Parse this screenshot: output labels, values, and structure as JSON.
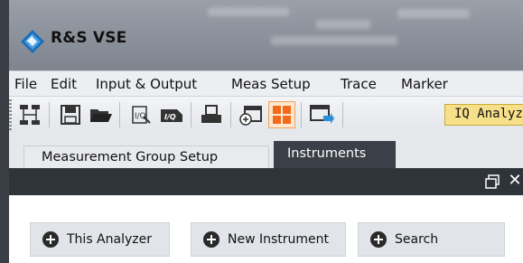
{
  "app": {
    "title": "R&S VSE"
  },
  "menu": {
    "items": [
      "File",
      "Edit",
      "Input & Output",
      "Meas Setup",
      "Trace",
      "Marker"
    ]
  },
  "toolbar": {
    "icons": [
      "measurement-overview-icon",
      "save-icon",
      "open-folder-icon",
      "print-setup-icon",
      "iq-data-icon",
      "print-icon",
      "add-window-icon",
      "layout-icon",
      "window-arrow-icon"
    ],
    "channel_label": "IQ Analyzer",
    "selected_color": "#f0a05a",
    "channel_color": "#f7e08a"
  },
  "tabs": [
    {
      "label": "Measurement Group Setup",
      "active": false
    },
    {
      "label": "Instruments",
      "active": true
    }
  ],
  "window_controls": {
    "close": "✕"
  },
  "buttons": [
    {
      "label": "This Analyzer",
      "icon": "add-circle-icon"
    },
    {
      "label": "New Instrument",
      "icon": "add-circle-icon"
    },
    {
      "label": "Search",
      "icon": "add-circle-icon"
    }
  ],
  "colors": {
    "dark_panel": "#2f343b",
    "active_tab": "#3b4048",
    "button_bg": "#e1e4e8"
  }
}
